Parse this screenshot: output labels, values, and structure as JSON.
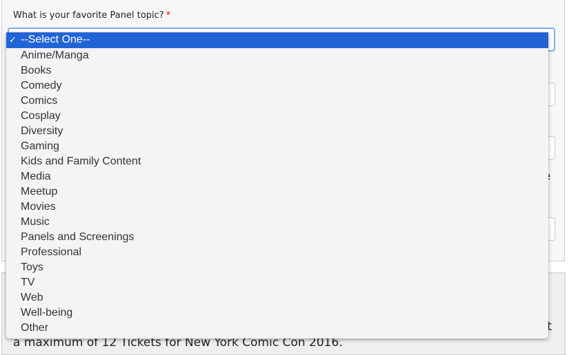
{
  "form": {
    "question_label": "What is your favorite Panel topic?",
    "required_marker": "*"
  },
  "dropdown": {
    "selected": "--Select One--",
    "check_icon": "✓",
    "options": [
      "--Select One--",
      "Anime/Manga",
      "Books",
      "Comedy",
      "Comics",
      "Cosplay",
      "Diversity",
      "Gaming",
      "Kids and Family Content",
      "Media",
      "Meetup",
      "Movies",
      "Music",
      "Panels and Screenings",
      "Professional",
      "Toys",
      "TV",
      "Web",
      "Well-being",
      "Other"
    ],
    "highlight_color": "#2264d6"
  },
  "footer": {
    "partial_char_right": "t",
    "partial_char_mid": "e",
    "text": "a maximum of 12 Tickets for New York Comic Con 2016."
  }
}
